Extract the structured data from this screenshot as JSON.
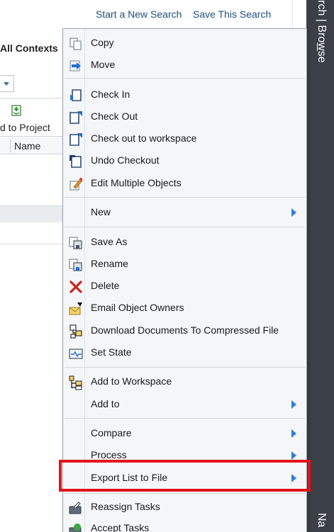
{
  "header": {
    "start_search": "Start a New Search",
    "save_search": "Save This Search"
  },
  "context_label": "All Contexts",
  "toolbar": {
    "add_to_project": "d to Project"
  },
  "table": {
    "name_header": "Name"
  },
  "side_panel": {
    "label_top": "rch | Browse",
    "label_bottom": "Na"
  },
  "menu": {
    "items": [
      {
        "label": "Copy",
        "icon": "copy-icon"
      },
      {
        "label": "Move",
        "icon": "move-icon"
      },
      {
        "label": "Check In",
        "icon": "check-in-icon"
      },
      {
        "label": "Check Out",
        "icon": "check-out-icon"
      },
      {
        "label": "Check out to workspace",
        "icon": "check-out-workspace-icon"
      },
      {
        "label": "Undo Checkout",
        "icon": "undo-checkout-icon"
      },
      {
        "label": "Edit Multiple Objects",
        "icon": "edit-multiple-icon"
      },
      {
        "label": "New",
        "submenu": true
      },
      {
        "label": "Save As",
        "icon": "save-as-icon"
      },
      {
        "label": "Rename",
        "icon": "rename-icon"
      },
      {
        "label": "Delete",
        "icon": "delete-icon"
      },
      {
        "label": "Email Object Owners",
        "icon": "email-icon"
      },
      {
        "label": "Download Documents To Compressed File",
        "icon": "download-icon"
      },
      {
        "label": "Set State",
        "icon": "set-state-icon"
      },
      {
        "label": "Add to Workspace",
        "icon": "add-workspace-icon"
      },
      {
        "label": "Add to",
        "submenu": true
      },
      {
        "label": "Compare",
        "submenu": true
      },
      {
        "label": "Process",
        "submenu": true
      },
      {
        "label": "Export List to File",
        "submenu": true,
        "highlighted": true
      },
      {
        "label": "Reassign Tasks",
        "icon": "reassign-tasks-icon"
      },
      {
        "label": "Accept Tasks",
        "icon": "accept-tasks-icon"
      }
    ]
  },
  "colors": {
    "highlight": "#e1141c",
    "link": "#1f4e7a",
    "submenu_arrow": "#2f7fd3",
    "side_panel": "#3b4046"
  }
}
